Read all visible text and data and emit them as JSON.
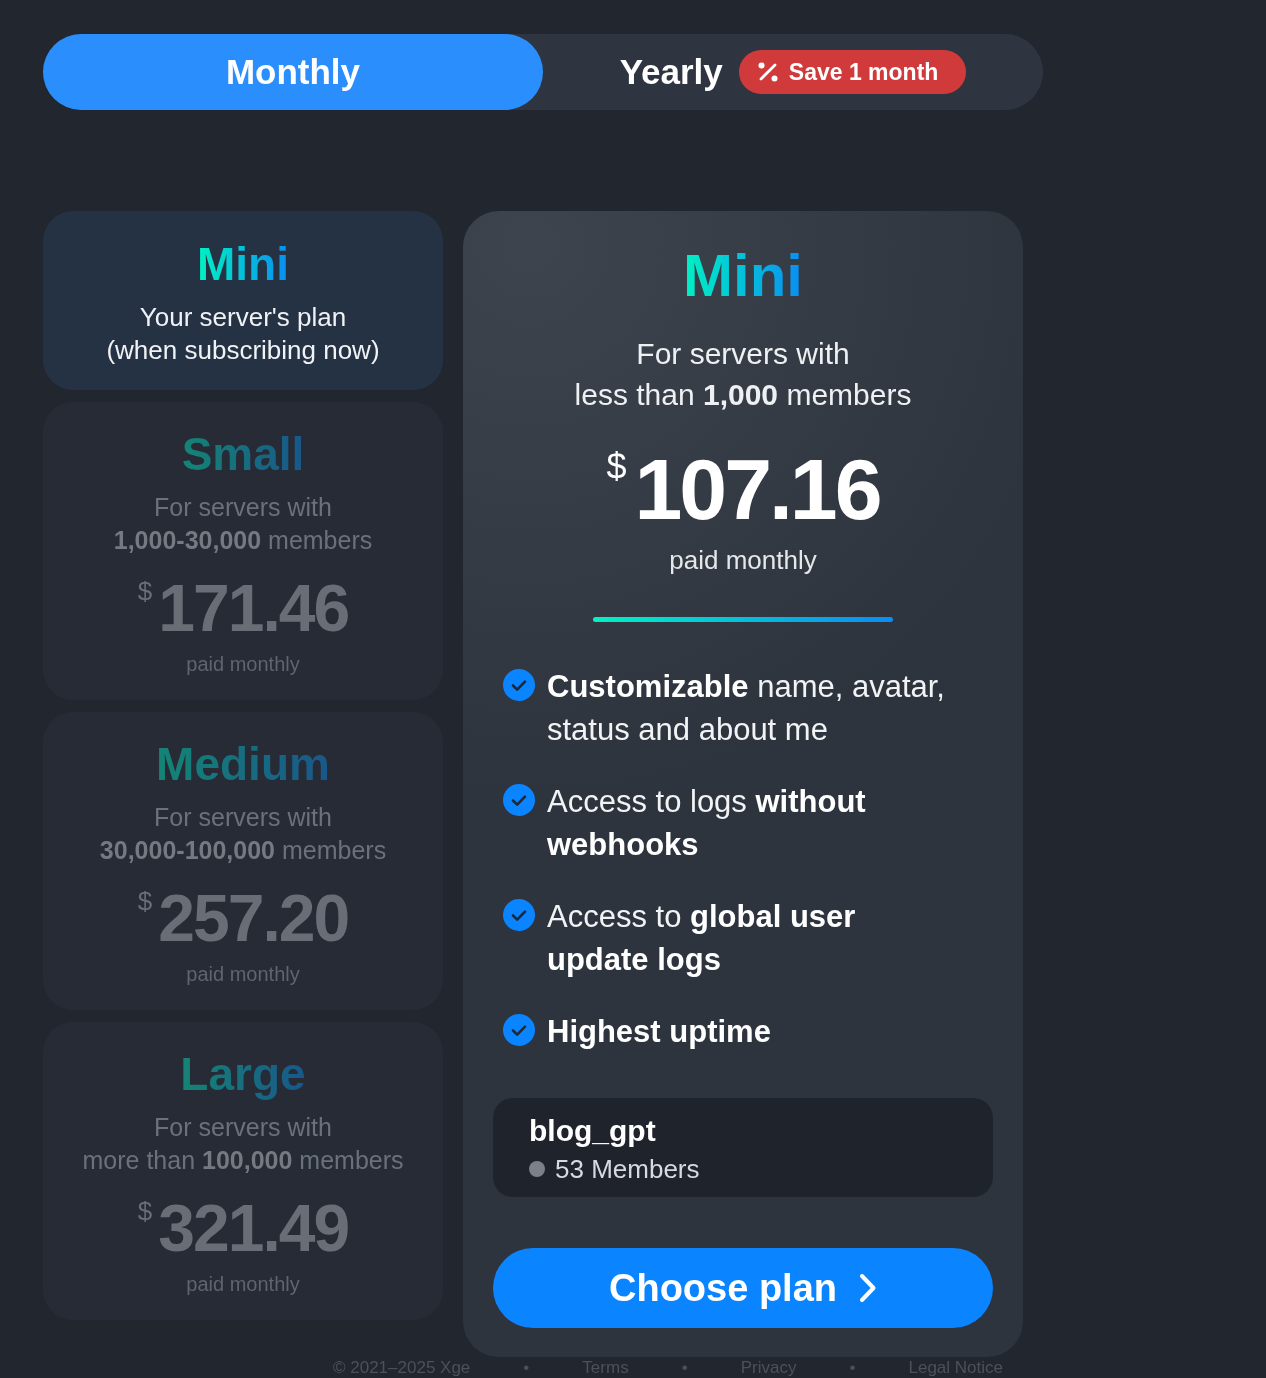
{
  "billing_toggle": {
    "options": [
      {
        "label": "Monthly",
        "selected": true
      },
      {
        "label": "Yearly",
        "selected": false,
        "badge": "Save 1 month"
      }
    ]
  },
  "plans": [
    {
      "name": "Mini",
      "selected": true,
      "note": "Your server's plan\n(when subscribing now)"
    },
    {
      "name": "Small",
      "selected": false,
      "description": "For servers with\n**1,000-30,000** members",
      "currency": "$",
      "price": "171.46",
      "period": "paid monthly"
    },
    {
      "name": "Medium",
      "selected": false,
      "description": "For servers with\n**30,000-100,000** members",
      "currency": "$",
      "price": "257.20",
      "period": "paid monthly"
    },
    {
      "name": "Large",
      "selected": false,
      "description": "For servers with\nmore than **100,000** members",
      "currency": "$",
      "price": "321.49",
      "period": "paid monthly"
    }
  ],
  "plan_details": {
    "name": "Mini",
    "description": "For servers with\nless than **1,000** members",
    "currency": "$",
    "price": "107.16",
    "period": "paid monthly",
    "features": [
      "**Customizable** name, avatar, status and about me",
      "Access to logs **without webhooks**",
      "Access to **global user update logs**",
      "**Highest uptime**"
    ],
    "server": {
      "name": "blog_gpt",
      "members": "53 Members"
    },
    "button": "Choose plan"
  },
  "footer": {
    "copyright": "© 2021–2025 Xge",
    "links": [
      "Terms",
      "Privacy",
      "Legal Notice"
    ],
    "separator": "•"
  }
}
